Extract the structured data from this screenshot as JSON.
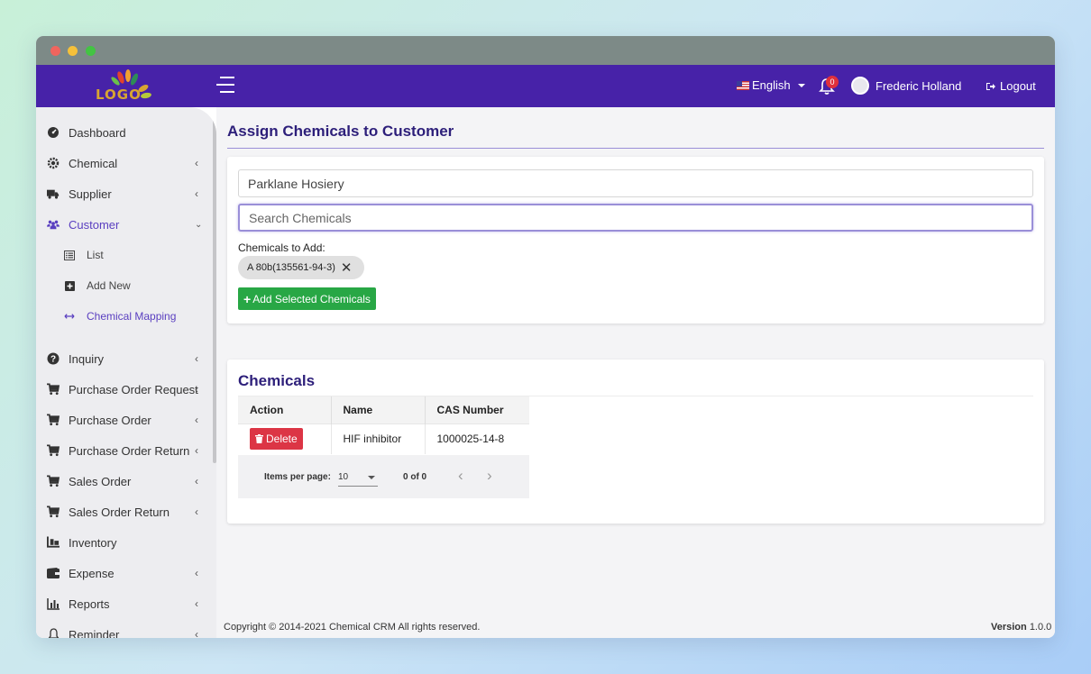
{
  "header": {
    "logo_text": "LOGO",
    "language": "English",
    "notification_count": "0",
    "user_name": "Frederic Holland",
    "logout_label": "Logout"
  },
  "sidebar": {
    "items": [
      {
        "label": "Dashboard",
        "icon": "dashboard-icon"
      },
      {
        "label": "Chemical",
        "icon": "gear-icon"
      },
      {
        "label": "Supplier",
        "icon": "truck-icon"
      },
      {
        "label": "Customer",
        "icon": "users-icon",
        "expanded": true
      },
      {
        "label": "Inquiry",
        "icon": "question-icon"
      },
      {
        "label": "Purchase Order Request",
        "icon": "cart-icon"
      },
      {
        "label": "Purchase Order",
        "icon": "cart-icon"
      },
      {
        "label": "Purchase Order Return",
        "icon": "cart-icon"
      },
      {
        "label": "Sales Order",
        "icon": "cart-icon"
      },
      {
        "label": "Sales Order Return",
        "icon": "cart-icon"
      },
      {
        "label": "Inventory",
        "icon": "warehouse-icon"
      },
      {
        "label": "Expense",
        "icon": "wallet-icon"
      },
      {
        "label": "Reports",
        "icon": "chart-icon"
      },
      {
        "label": "Reminder",
        "icon": "bell-icon"
      }
    ],
    "customer_sub": [
      {
        "label": "List",
        "icon": "list-icon"
      },
      {
        "label": "Add New",
        "icon": "plus-square-icon"
      },
      {
        "label": "Chemical Mapping",
        "icon": "arrows-horizontal-icon",
        "active": true
      }
    ]
  },
  "main": {
    "title": "Assign Chemicals to Customer",
    "customer_value": "Parklane Hosiery",
    "search_placeholder": "Search Chemicals",
    "chemicals_to_add_label": "Chemicals to Add:",
    "selected_chip": "A 80b(135561-94-3)",
    "add_button": "Add Selected Chemicals",
    "chemicals_title": "Chemicals",
    "table": {
      "headers": [
        "Action",
        "Name",
        "CAS Number"
      ],
      "rows": [
        {
          "action": "Delete",
          "name": "HIF inhibitor",
          "cas": "1000025-14-8"
        }
      ]
    },
    "paginator": {
      "items_per_page_label": "Items per page:",
      "page_size": "10",
      "range": "0 of 0"
    }
  },
  "footer": {
    "copyright": "Copyright © 2014-2021 Chemical CRM All rights reserved.",
    "version_label": "Version",
    "version_value": "1.0.0"
  },
  "colors": {
    "topbar": "#4722a8",
    "accent": "#5a3fc0",
    "success": "#28a745",
    "danger": "#dc3545"
  }
}
